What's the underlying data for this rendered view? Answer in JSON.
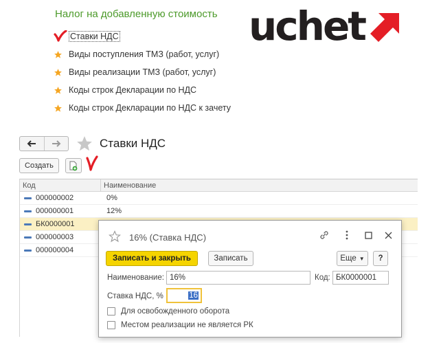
{
  "section": {
    "title": "Налог на добавленную стоимость",
    "links": [
      {
        "label": "Ставки НДС",
        "active": true
      },
      {
        "label": "Виды поступления ТМЗ (работ, услуг)"
      },
      {
        "label": "Виды реализации ТМЗ (работ, услуг)"
      },
      {
        "label": "Коды строк Декларации по НДС"
      },
      {
        "label": "Коды строк Декларации по НДС к зачету"
      }
    ]
  },
  "logo": {
    "text": "uchet",
    "text_color": "#231f20",
    "arrow_color": "#e41e26"
  },
  "colors": {
    "accent_star": "#f5a623",
    "mark_red": "#e41e26",
    "title_green": "#4c9a2a",
    "primary_button": "#f5d400"
  },
  "list_form": {
    "title": "Ставки НДС",
    "create_label": "Создать",
    "columns": {
      "code": "Код",
      "name": "Наименование"
    },
    "rows": [
      {
        "code": "000000002",
        "name": "0%"
      },
      {
        "code": "000000001",
        "name": "12%"
      },
      {
        "code": "БК0000001",
        "name": "",
        "selected": true
      },
      {
        "code": "000000003",
        "name": ""
      },
      {
        "code": "000000004",
        "name": ""
      }
    ]
  },
  "dialog": {
    "title": "16% (Ставка НДС)",
    "save_close_label": "Записать и закрыть",
    "save_label": "Записать",
    "more_label": "Еще",
    "help_label": "?",
    "name_label": "Наименование:",
    "name_value": "16%",
    "code_label": "Код:",
    "code_value": "БК0000001",
    "rate_label": "Ставка НДС, % :",
    "rate_value": "16",
    "checkbox_exempt": "Для освобожденного оборота",
    "checkbox_not_rk": "Местом реализации не является РК"
  }
}
